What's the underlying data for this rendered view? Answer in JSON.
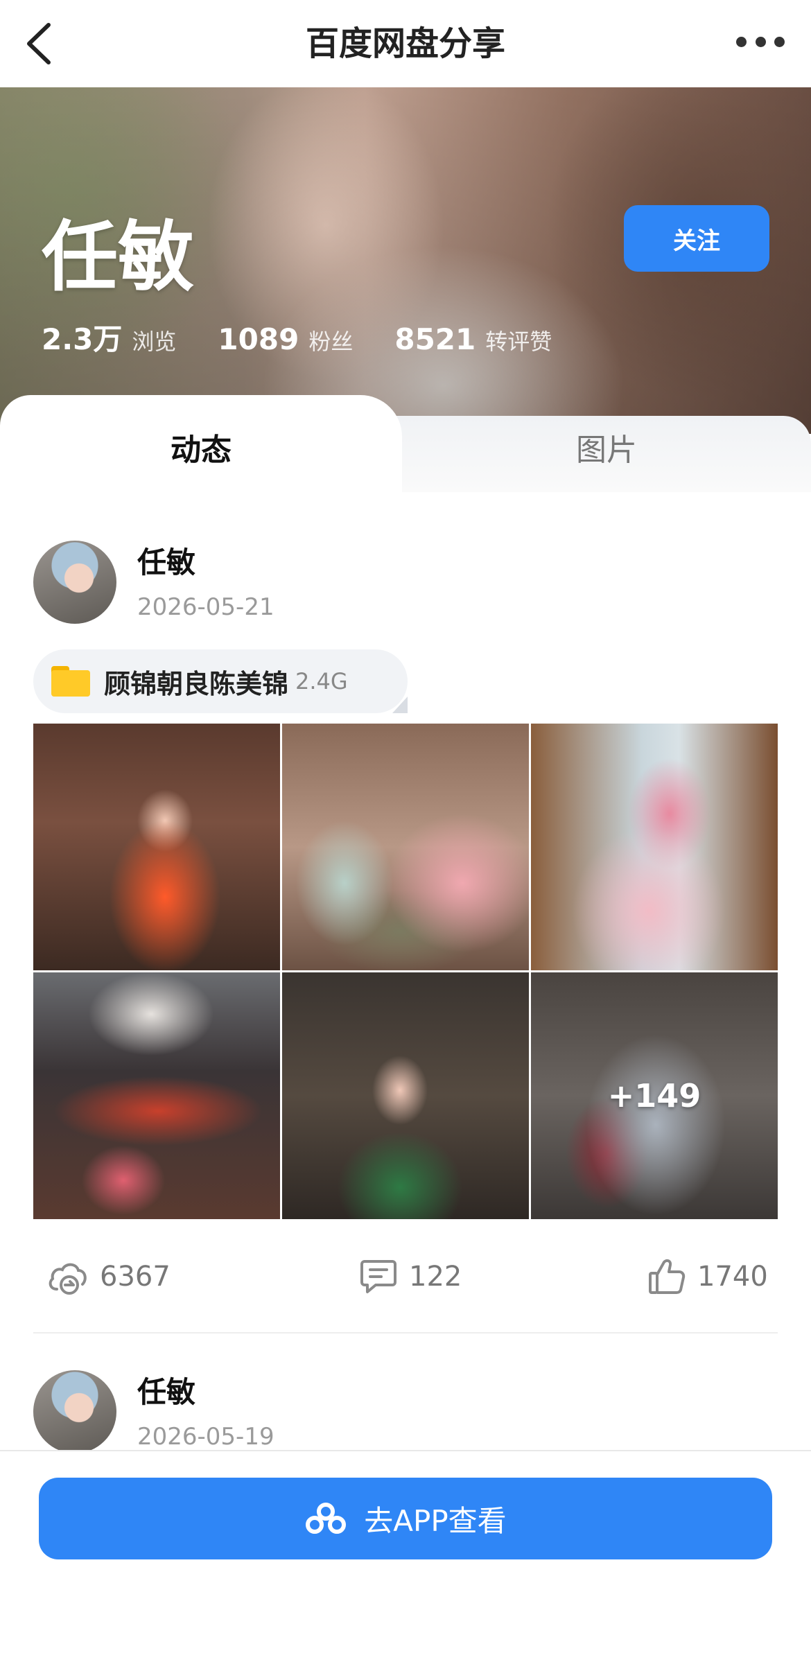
{
  "nav": {
    "title": "百度网盘分享"
  },
  "profile": {
    "name": "任敏",
    "follow_label": "关注",
    "stats": [
      {
        "value": "2.3万",
        "label": "浏览"
      },
      {
        "value": "1089",
        "label": "粉丝"
      },
      {
        "value": "8521",
        "label": "转评赞"
      }
    ]
  },
  "tabs": [
    {
      "label": "动态",
      "active": true
    },
    {
      "label": "图片",
      "active": false
    }
  ],
  "posts": [
    {
      "author": "任敏",
      "date": "2026-05-21",
      "folder": {
        "name": "顾锦朝良陈美锦",
        "size": "2.4G"
      },
      "more_count": "+149",
      "actions": {
        "saves": "6367",
        "comments": "122",
        "likes": "1740"
      }
    },
    {
      "author": "任敏",
      "date": "2026-05-19"
    }
  ],
  "bottom": {
    "button_label": "去APP查看"
  },
  "colors": {
    "accent": "#2f86f6",
    "folder": "#ffca28"
  }
}
